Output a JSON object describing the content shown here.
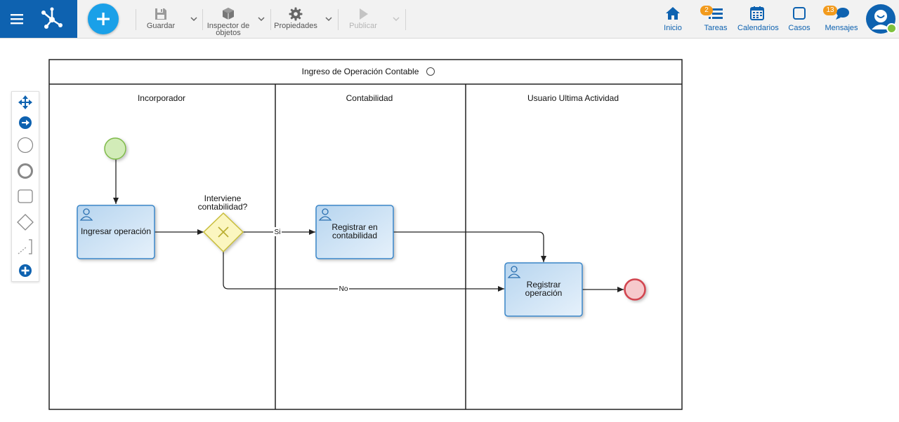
{
  "toolbar": {
    "save_label": "Guardar",
    "inspector_label": "Inspector de objetos",
    "inspector_line1": "Inspector de",
    "inspector_line2": "objetos",
    "properties_label": "Propiedades",
    "publish_label": "Publicar"
  },
  "nav": {
    "home": "Inicio",
    "tasks": "Tareas",
    "tasks_badge": "2",
    "calendars": "Calendarios",
    "cases": "Casos",
    "messages": "Mensajes",
    "messages_badge": "13"
  },
  "icons": {
    "menu": "hamburger-icon",
    "logo": "network-logo-icon",
    "add": "plus-icon",
    "save": "floppy-disk-icon",
    "inspector": "cube-icon",
    "properties": "gear-icon",
    "publish": "play-icon",
    "home": "house-icon",
    "tasks": "task-list-icon",
    "calendars": "calendar-icon",
    "cases": "square-icon",
    "messages": "chat-bubble-icon"
  },
  "colors": {
    "brand": "#0e62b0",
    "accent": "#1aa0e8",
    "badge": "#f29a1c",
    "task_fill": "#c6def2",
    "task_stroke": "#3b86c8",
    "gateway_fill": "#fbf6c0",
    "start_fill": "#d2ecb8",
    "end_fill": "#f6c9cc"
  },
  "palette": {
    "items": [
      "move-tool",
      "connect-tool",
      "start-event-tool",
      "end-event-tool",
      "task-tool",
      "gateway-tool",
      "lane-tool",
      "more-tool"
    ]
  },
  "diagram": {
    "pool_title": "Ingreso de Operación Contable",
    "lanes": [
      "Incorporador",
      "Contabilidad",
      "Usuario Ultima Actividad"
    ],
    "tasks": {
      "ingresar": "Ingresar operación",
      "registrar_contabilidad_1": "Registrar en",
      "registrar_contabilidad_2": "contabilidad",
      "registrar_operacion_1": "Registrar",
      "registrar_operacion_2": "operación"
    },
    "gateway_label_1": "Interviene",
    "gateway_label_2": "contabilidad?",
    "flow_yes": "Si",
    "flow_no": "No"
  }
}
